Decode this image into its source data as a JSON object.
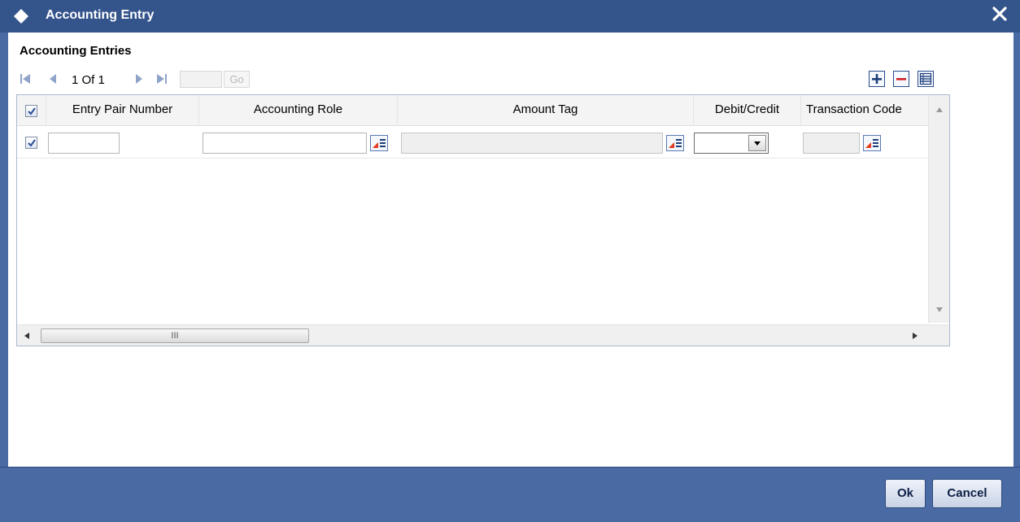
{
  "window": {
    "title": "Accounting Entry"
  },
  "section": {
    "title": "Accounting Entries"
  },
  "pager": {
    "page_text": "1 Of 1",
    "go_label": "Go",
    "page_input_value": ""
  },
  "grid": {
    "columns": [
      "Entry Pair Number",
      "Accounting Role",
      "Amount Tag",
      "Debit/Credit",
      "Transaction Code"
    ],
    "rows": [
      {
        "checked": true,
        "entry_pair_number": "",
        "accounting_role": "",
        "amount_tag": "",
        "debit_credit": "",
        "transaction_code": ""
      }
    ],
    "scroll_thumb_label": "III"
  },
  "buttons": {
    "ok": "Ok",
    "cancel": "Cancel"
  },
  "colors": {
    "titlebar": "#34548c",
    "frame": "#4a6aa3",
    "accent_icon": "#1f3f7a",
    "lov_red": "#e23b1f"
  }
}
